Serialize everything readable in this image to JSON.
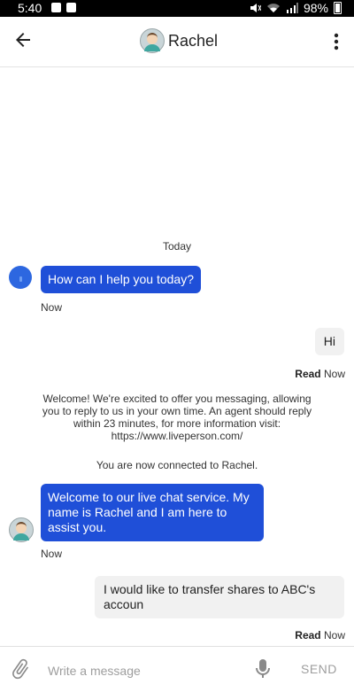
{
  "status_bar": {
    "time": "5:40",
    "battery": "98%"
  },
  "header": {
    "title": "Rachel"
  },
  "chat": {
    "date": "Today",
    "messages": [
      {
        "text": "How can I help you today?",
        "time": "Now"
      },
      {
        "text": "Hi",
        "status": "Read",
        "time": "Now"
      },
      {
        "text": "Welcome! We're excited to offer you messaging, allowing you to reply to us in your own time. An agent should reply within 23 minutes, for more information visit: https://www.liveperson.com/"
      },
      {
        "text": "You are now connected to Rachel."
      },
      {
        "text": "Welcome to our live chat service. My name is Rachel and I am here to assist you.",
        "time": "Now"
      },
      {
        "text": "I would like to transfer shares to ABC's accoun",
        "status": "Read",
        "time": "Now"
      }
    ]
  },
  "composer": {
    "placeholder": "Write a message",
    "send_label": "SEND"
  }
}
